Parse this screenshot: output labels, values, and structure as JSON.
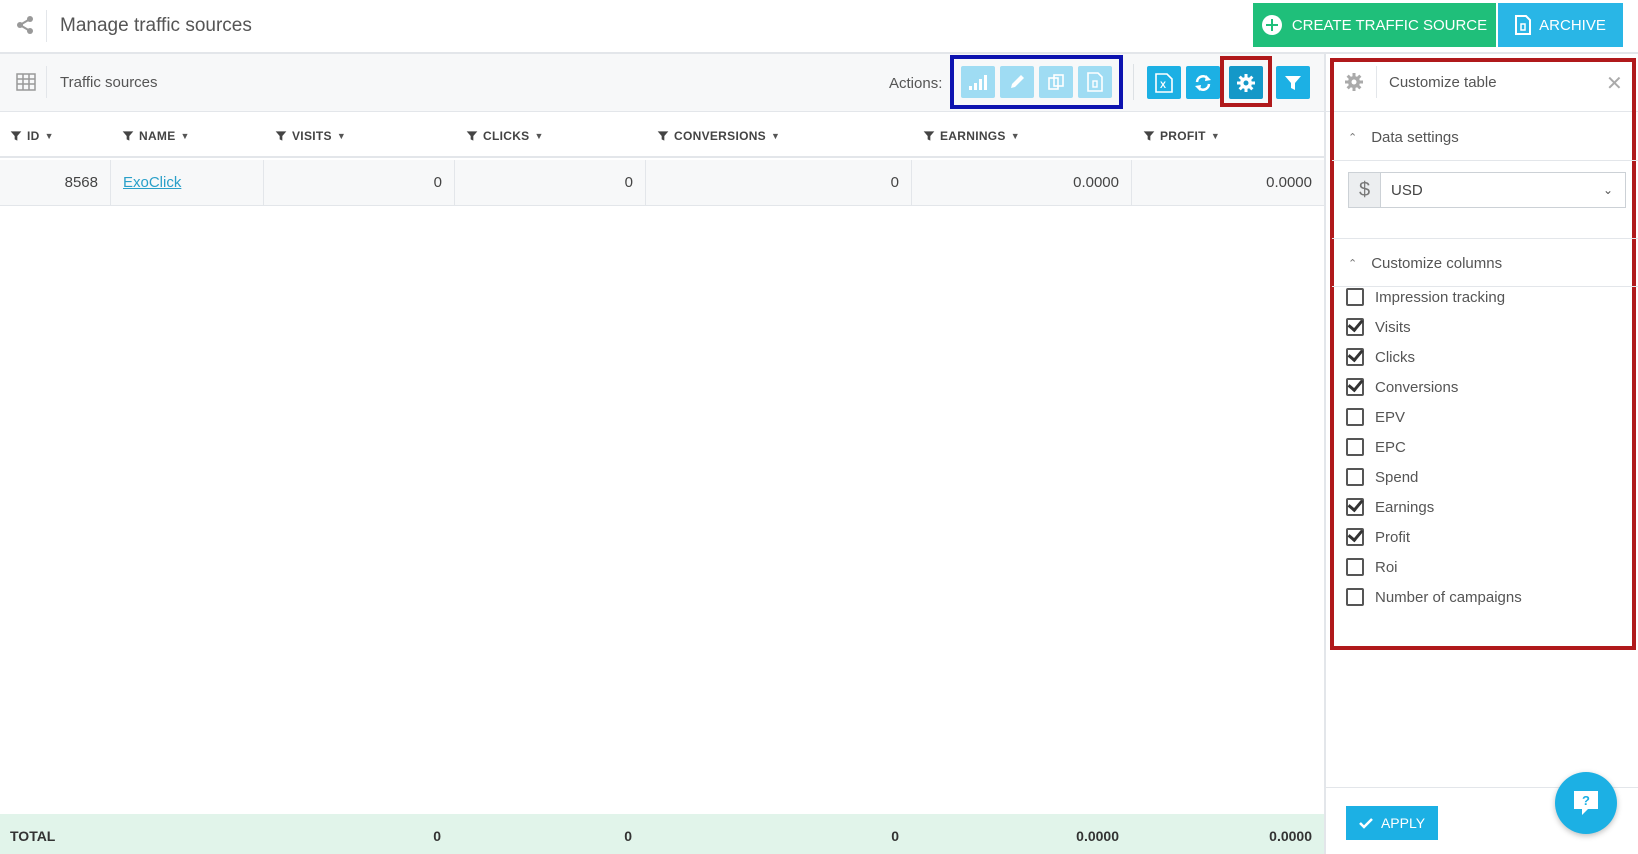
{
  "header": {
    "title": "Manage traffic sources",
    "create_label": "CREATE TRAFFIC SOURCE",
    "archive_label": "ARCHIVE"
  },
  "toolbar": {
    "title": "Traffic sources",
    "actions_label": "Actions:"
  },
  "table": {
    "columns": [
      "ID",
      "NAME",
      "VISITS",
      "CLICKS",
      "CONVERSIONS",
      "EARNINGS",
      "PROFIT"
    ],
    "rows": [
      {
        "id": "8568",
        "name": "ExoClick",
        "visits": "0",
        "clicks": "0",
        "conversions": "0",
        "earnings": "0.0000",
        "profit": "0.0000"
      }
    ],
    "totals": {
      "label": "TOTAL",
      "visits": "0",
      "clicks": "0",
      "conversions": "0",
      "earnings": "0.0000",
      "profit": "0.0000"
    }
  },
  "panel": {
    "title": "Customize table",
    "data_settings_label": "Data settings",
    "currency_symbol": "$",
    "currency_value": "USD",
    "customize_columns_label": "Customize columns",
    "columns": [
      {
        "label": "Impression tracking",
        "checked": false
      },
      {
        "label": "Visits",
        "checked": true
      },
      {
        "label": "Clicks",
        "checked": true
      },
      {
        "label": "Conversions",
        "checked": true
      },
      {
        "label": "EPV",
        "checked": false
      },
      {
        "label": "EPC",
        "checked": false
      },
      {
        "label": "Spend",
        "checked": false
      },
      {
        "label": "Earnings",
        "checked": true
      },
      {
        "label": "Profit",
        "checked": true
      },
      {
        "label": "Roi",
        "checked": false
      },
      {
        "label": "Number of campaigns",
        "checked": false
      }
    ],
    "apply_label": "APPLY"
  },
  "colors": {
    "green": "#1fbf7a",
    "blue": "#1cb0e4",
    "light_blue": "#9fdcf3",
    "highlight_blue": "#0d13b0",
    "highlight_red": "#b0191b",
    "totals_bg": "#e1f4ea"
  },
  "icons": [
    "share-icon",
    "plus-circle-icon",
    "archive-icon",
    "table-icon",
    "bar-chart-icon",
    "pencil-icon",
    "duplicate-icon",
    "archive-doc-icon",
    "excel-icon",
    "refresh-icon",
    "gear-icon",
    "filter-icon",
    "close-icon",
    "chevron-up-icon",
    "chevron-down-icon",
    "check-icon",
    "help-chat-icon"
  ]
}
